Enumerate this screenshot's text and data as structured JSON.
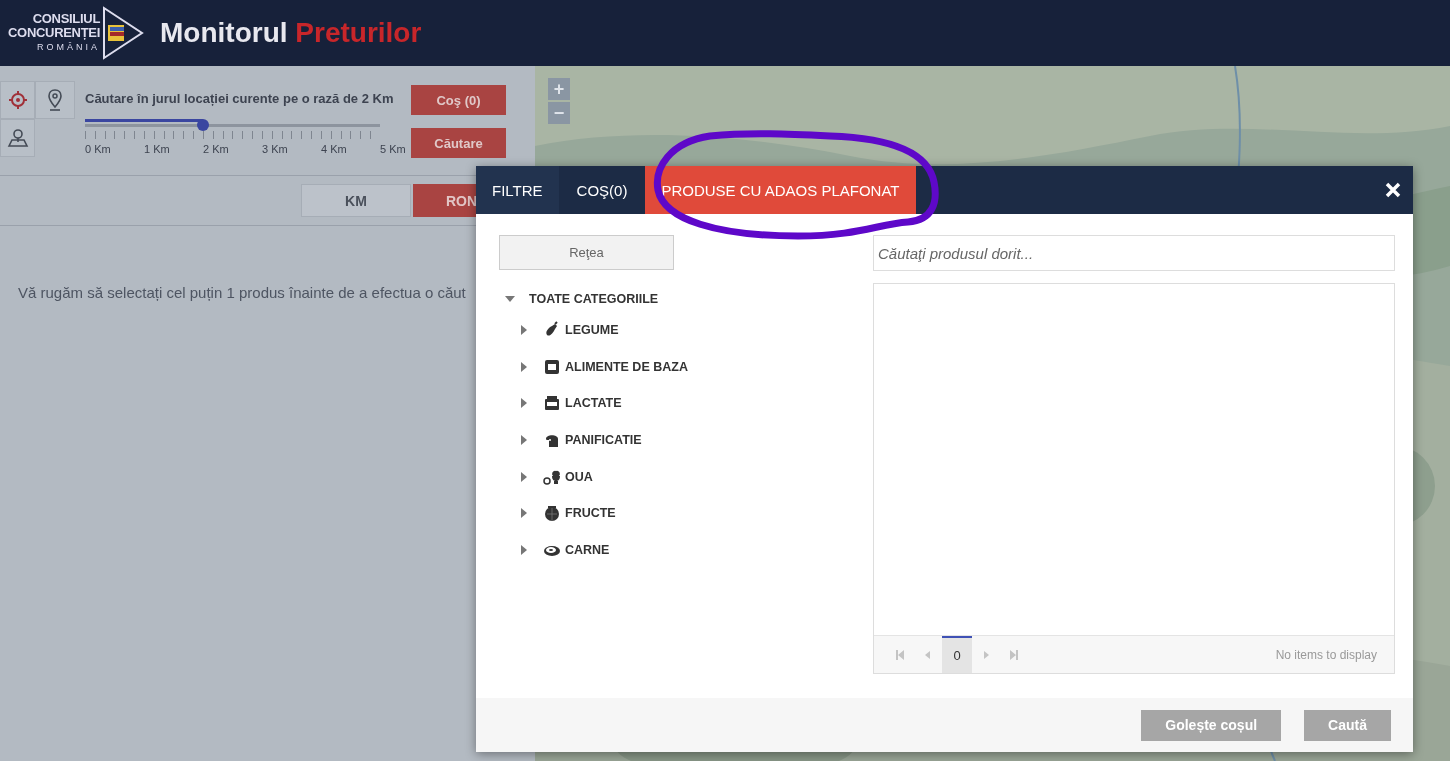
{
  "header": {
    "logo_lines": [
      "CONSILIUL",
      "CONCURENȚEI",
      "ROMÂNIA"
    ],
    "title": "Monitorul",
    "title_accent": "Preturilor"
  },
  "search_panel": {
    "radius_label": "Căutare în jurul locației curente pe o rază de 2 Km",
    "slider": {
      "level": 0.4,
      "ticks": [
        "0 Km",
        "1 Km",
        "2 Km",
        "3 Km",
        "4 Km",
        "5 Km"
      ]
    },
    "buttons": [
      "Coş (0)",
      "Căutare"
    ]
  },
  "unit_toggle": [
    {
      "label": "KM",
      "selected": false
    },
    {
      "label": "RON",
      "selected": true
    }
  ],
  "message": "Vă rugăm să selectați cel puțin 1 produs înainte de a efectua o căut",
  "map": {
    "zoom_controls": [
      "+",
      "−"
    ]
  },
  "dialog": {
    "tabs": [
      {
        "label": "FILTRE",
        "selected": false
      },
      {
        "label": "COŞ(0)",
        "selected": false
      },
      {
        "label": "PRODUSE CU ADAOS PLAFONAT",
        "selected": true
      }
    ],
    "network_button": "Reţea",
    "category_tree": {
      "label": "TOATE CATEGORIILE",
      "expanded": true,
      "children": [
        {
          "label": "LEGUME",
          "expanded": false
        },
        {
          "label": "ALIMENTE DE BAZA",
          "expanded": false
        },
        {
          "label": "LACTATE",
          "expanded": false
        },
        {
          "label": "PANIFICATIE",
          "expanded": false
        },
        {
          "label": "OUA",
          "expanded": false
        },
        {
          "label": "FRUCTE",
          "expanded": false
        },
        {
          "label": "CARNE",
          "expanded": false
        }
      ]
    },
    "search": {
      "placeholder": "Căutaţi produsul dorit..."
    },
    "pager": {
      "page": "0",
      "status": "No items to display"
    },
    "footer_buttons": [
      "Golește coșul",
      "Caută"
    ]
  },
  "highlight_mark": {
    "kind": "ellipse"
  }
}
